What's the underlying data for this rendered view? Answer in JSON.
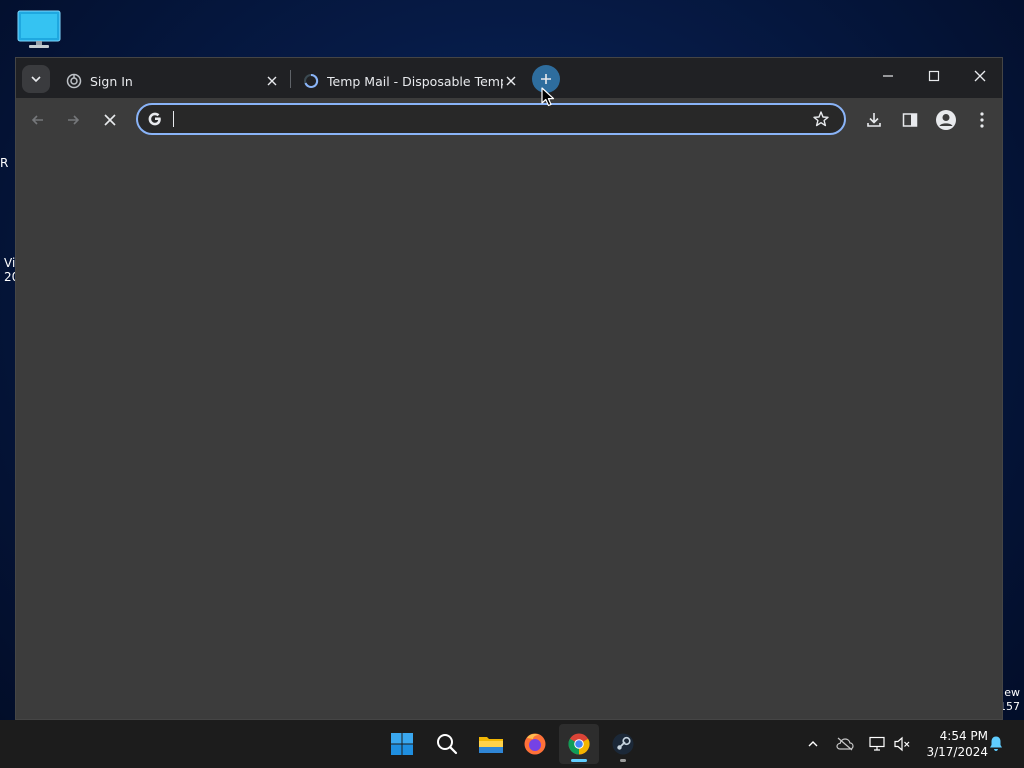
{
  "desktop": {
    "left_fragments": [
      "R",
      "Vi",
      "20"
    ],
    "right_fragments": [
      "ew",
      "157"
    ]
  },
  "browser": {
    "tabs": [
      {
        "title": "Sign In",
        "favicon": "circle-logo-icon"
      },
      {
        "title": "Temp Mail - Disposable Tempor",
        "favicon": "loading-spinner-icon"
      }
    ],
    "omnibox": {
      "value": "",
      "placeholder": ""
    },
    "icons": {
      "back": "arrow-left-icon",
      "forward": "arrow-right-icon",
      "stop": "close-icon",
      "bookmark": "star-icon",
      "downloads": "download-icon",
      "side_panel": "side-panel-icon",
      "profile": "person-icon",
      "menu": "kebab-menu-icon"
    }
  },
  "taskbar": {
    "apps": [
      "windows-start-icon",
      "search-icon",
      "file-explorer-icon",
      "firefox-icon",
      "chrome-icon",
      "steam-icon"
    ],
    "clock": {
      "time": "4:54 PM",
      "date": "3/17/2024"
    }
  },
  "colors": {
    "accent": "#8ab4f8",
    "tabstrip": "#202124",
    "toolbar": "#3c3c3c",
    "taskbar": "#1c1c1c",
    "newtab_highlight": "#2e6d9e"
  }
}
